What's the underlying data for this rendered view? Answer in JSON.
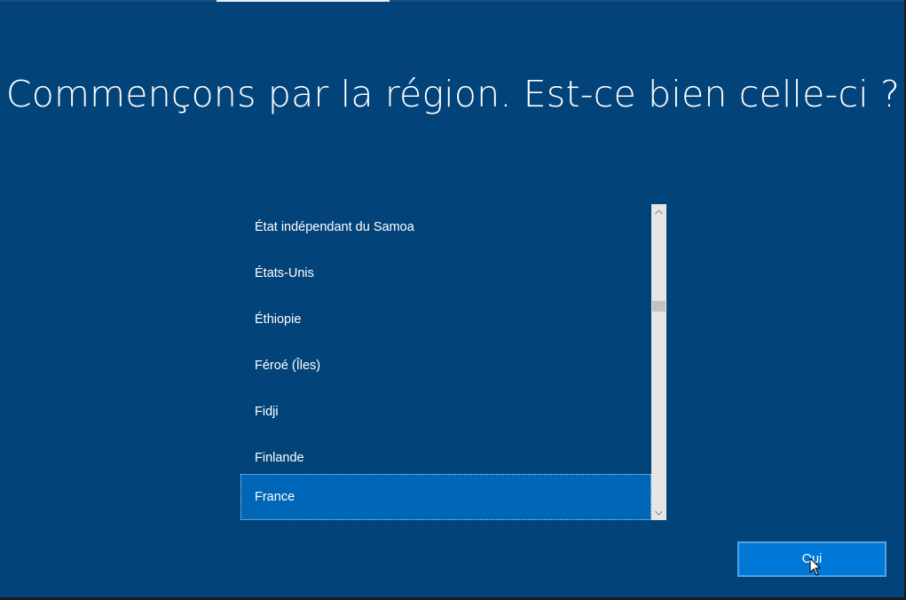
{
  "header": {
    "title": "Commençons par la région. Est-ce bien celle-ci ?"
  },
  "region_list": {
    "items": [
      {
        "label": "État indépendant du Samoa",
        "selected": false
      },
      {
        "label": "États-Unis",
        "selected": false
      },
      {
        "label": "Éthiopie",
        "selected": false
      },
      {
        "label": "Féroé (Îles)",
        "selected": false
      },
      {
        "label": "Fidji",
        "selected": false
      },
      {
        "label": "Finlande",
        "selected": false
      },
      {
        "label": "France",
        "selected": true
      }
    ],
    "selected_value": "France"
  },
  "footer": {
    "confirm_label": "Oui"
  },
  "colors": {
    "background": "#02447a",
    "selection": "#0067b8",
    "button": "#0078d7",
    "button_border": "#4fa3e8",
    "scrollbar_track": "#e6e6e6",
    "scrollbar_thumb": "#c2c2c2"
  },
  "icons": {
    "scroll_up": "chevron-up-icon",
    "scroll_down": "chevron-down-icon",
    "cursor": "mouse-pointer-icon"
  }
}
